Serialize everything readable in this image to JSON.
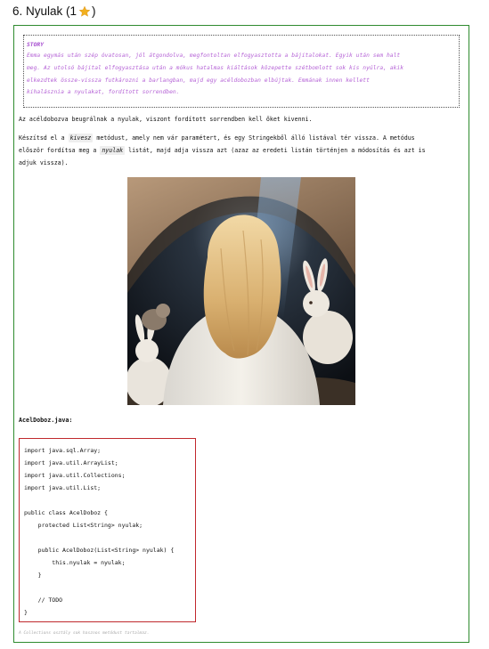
{
  "heading": {
    "title": "6. Nyulak (1",
    "close_paren": ")",
    "star_color": "#f2b01e"
  },
  "story": {
    "title": "STORY",
    "lines": [
      "Emma egymás után szép óvatosan, jól átgondolva, megfontoltan elfogyasztotta a bájitalokat. Egyik után sem halt",
      "meg. Az utolsó bájital elfogyasztása után a mókus hatalmas kiáltások közepette szétbomlott sok kis nyúlra, akik",
      "elkezdtek össze-vissza futkározni a barlangban, majd egy acéldobozban elbújtak. Emmának innen kellett",
      "kihalásznia a nyulakat, fordított sorrendben."
    ],
    "color": "#b563d6"
  },
  "intro": "Az acéldobozva beugrálnak a nyulak, viszont fordított sorrendben kell őket kivenni.",
  "task": {
    "line1_before": "Készítsd el a ",
    "method_name": "kivesz",
    "line1_after": " metódust, amely nem vár paramétert, és egy Stringekből álló listával tér vissza. A metódus",
    "line2_before": "először fordítsa meg a ",
    "field_name": "nyulak",
    "line2_after": " listát, majd adja vissza azt (azaz az eredeti listán történjen a módosítás és azt is",
    "line3": "adjuk vissza)."
  },
  "file_label": "AcelDoboz.java:",
  "code_lines": [
    "import java.sql.Array;",
    "import java.util.ArrayList;",
    "import java.util.Collections;",
    "import java.util.List;",
    "",
    "public class AcelDoboz {",
    "    protected List<String> nyulak;",
    "",
    "    public AcelDoboz(List<String> nyulak) {",
    "        this.nyulak = nyulak;",
    "    }",
    "",
    "    // TODO",
    "}"
  ],
  "footnote": "A Collections osztály sok hasznos metódust tartalmaz.",
  "colors": {
    "frame_border": "#2e8b2e",
    "code_border": "#c0282d"
  }
}
